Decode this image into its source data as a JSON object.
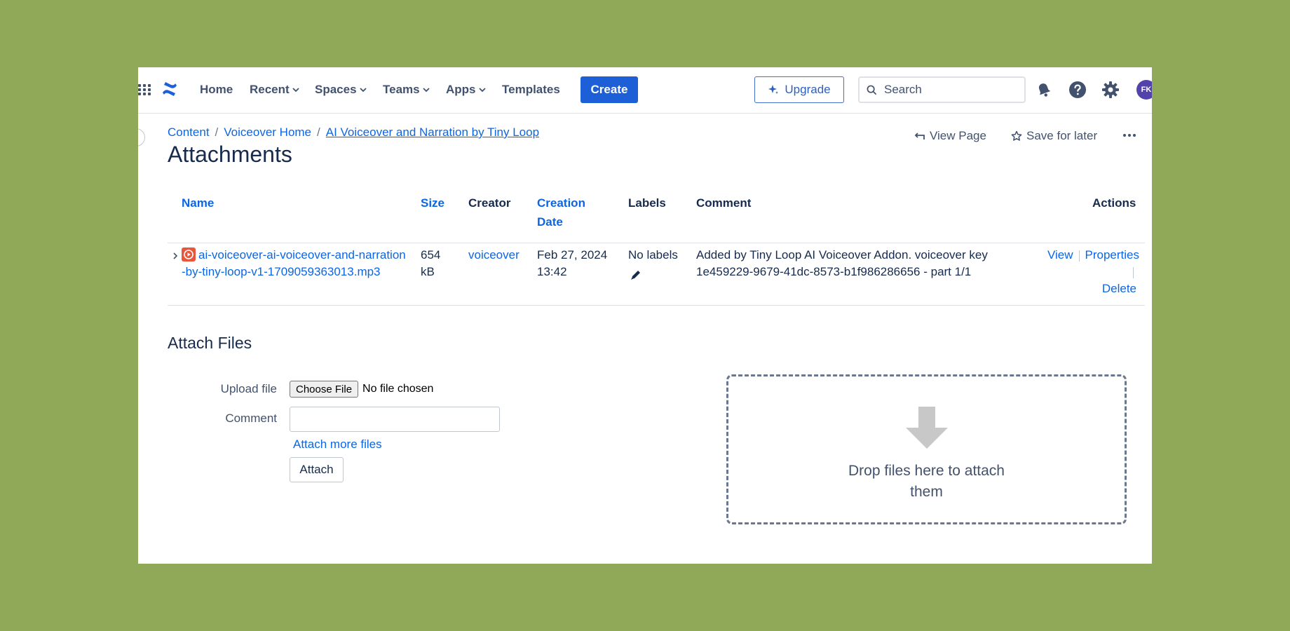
{
  "nav": {
    "items": [
      {
        "label": "Home",
        "has_menu": false
      },
      {
        "label": "Recent",
        "has_menu": true
      },
      {
        "label": "Spaces",
        "has_menu": true
      },
      {
        "label": "Teams",
        "has_menu": true
      },
      {
        "label": "Apps",
        "has_menu": true
      },
      {
        "label": "Templates",
        "has_menu": false
      }
    ],
    "create_label": "Create",
    "upgrade_label": "Upgrade",
    "search_placeholder": "Search",
    "avatar_initials": "FK",
    "brand_color": "#1d5fd6"
  },
  "breadcrumb": {
    "items": [
      "Content",
      "Voiceover Home",
      "AI Voiceover and Narration by Tiny Loop"
    ],
    "separator": "/"
  },
  "page_actions": {
    "view_page": "View Page",
    "save_for_later": "Save for later"
  },
  "page": {
    "title": "Attachments"
  },
  "table": {
    "headers": {
      "name": "Name",
      "size": "Size",
      "creator": "Creator",
      "creation_date_line1": "Creation",
      "creation_date_line2": "Date",
      "labels": "Labels",
      "comment": "Comment",
      "actions": "Actions"
    },
    "rows": [
      {
        "name": "ai-voiceover-ai-voiceover-and-narration-by-tiny-loop-v1-1709059363013.mp3",
        "size_line1": "654",
        "size_line2": "kB",
        "creator": "voiceover",
        "date_line1": "Feb 27, 2024",
        "date_line2": "13:42",
        "labels": "No labels",
        "comment_line1": "Added by Tiny Loop AI Voiceover Addon. voiceover key",
        "comment_line2": "1e459229-9679-41dc-8573-b1f986286656 - part 1/1",
        "actions": {
          "view": "View",
          "properties": "Properties",
          "delete": "Delete"
        }
      }
    ]
  },
  "attach": {
    "section_title": "Attach Files",
    "upload_label": "Upload file",
    "choose_button": "Choose File",
    "no_file_text": "No file chosen",
    "comment_label": "Comment",
    "comment_value": "",
    "attach_more": "Attach more files",
    "attach_button": "Attach",
    "drop_text": "Drop files here to attach them"
  }
}
